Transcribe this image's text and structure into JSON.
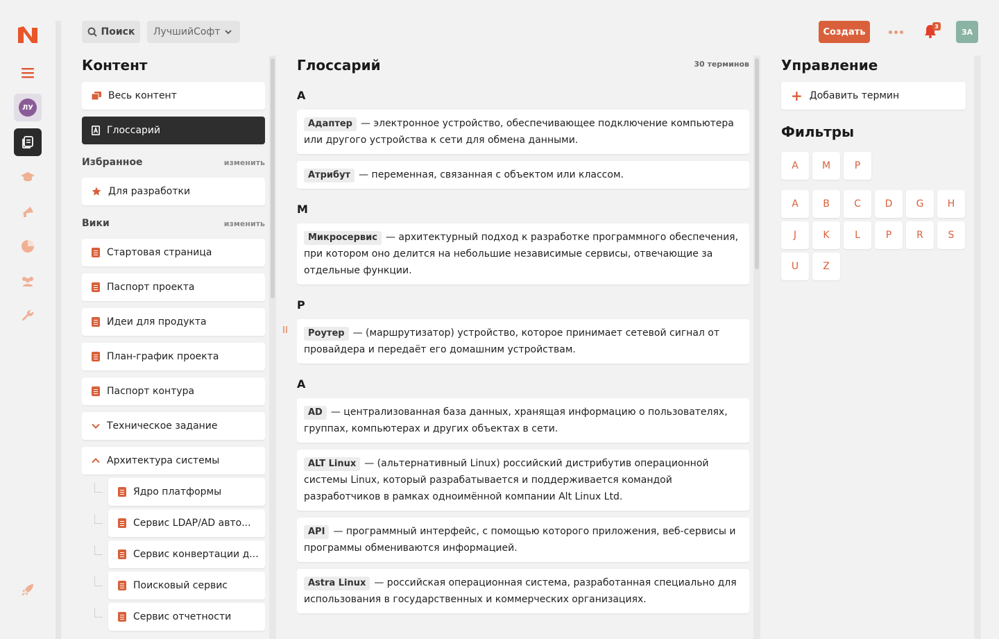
{
  "topbar": {
    "search_label": "Поиск",
    "org_name": "ЛучшийСофт",
    "create_label": "Создать",
    "notifications_count": "3",
    "user_initials": "ЗА"
  },
  "rail": {
    "space_initials": "ЛУ"
  },
  "content_panel": {
    "title": "Контент",
    "all_content": "Весь контент",
    "glossary": "Глоссарий",
    "favorites_title": "Избранное",
    "favorites_edit": "изменить",
    "favorites": [
      "Для разработки"
    ],
    "wiki_title": "Вики",
    "wiki_edit": "изменить",
    "wiki_items": [
      "Стартовая страница",
      "Паспорт проекта",
      "Идеи для продукта",
      "План-график проекта",
      "Паспорт контура"
    ],
    "tech_spec": "Техническое задание",
    "arch": "Архитектура системы",
    "arch_children": [
      "Ядро платформы",
      "Сервис LDAP/AD авто...",
      "Сервис конвертации д...",
      "Поисковый сервис",
      "Сервис отчетности"
    ]
  },
  "glossary": {
    "title": "Глоссарий",
    "count": "30 терминов",
    "groups": [
      {
        "letter": "А",
        "terms": [
          {
            "term": "Адаптер",
            "def": "— электронное устройство, обеспечивающее подключение компьютера или другого устройства к сети для обмена данными."
          },
          {
            "term": "Атрибут",
            "def": "— переменная, связанная с объектом или классом."
          }
        ]
      },
      {
        "letter": "М",
        "terms": [
          {
            "term": "Микросервис",
            "def": "— архитектурный подход к разработке программного обеспечения, при котором оно делится на небольшие независимые сервисы, отвечающие за отдельные функции."
          }
        ]
      },
      {
        "letter": "Р",
        "terms": [
          {
            "term": "Роутер",
            "def": "— (маршрутизатор) устройство, которое принимает сетевой сигнал от провайдера и передаёт его домашним устройствам."
          }
        ]
      },
      {
        "letter": "A",
        "terms": [
          {
            "term": "AD",
            "def": "— централизованная база данных, хранящая информацию о пользователях, группах, компьютерах и других объектах в сети."
          },
          {
            "term": "ALT Linux",
            "def": "— (альтернативный Linux) российский дистрибутив операционной системы Linux, который разрабатывается и поддерживается командой разработчиков в рамках одноимённой компании Alt Linux Ltd."
          },
          {
            "term": "API",
            "def": "— программный интерфейс, с помощью которого приложения, веб-сервисы и программы обмениваются информацией."
          },
          {
            "term": "Astra Linux",
            "def": "— российская операционная система, разработанная специально для использования в государственных и коммерческих организациях."
          }
        ]
      }
    ]
  },
  "management": {
    "title": "Управление",
    "add_term": "Добавить термин",
    "filters_title": "Фильтры",
    "cyrillic_letters": [
      "А",
      "М",
      "Р"
    ],
    "latin_letters": [
      "A",
      "B",
      "C",
      "D",
      "G",
      "H",
      "J",
      "K",
      "L",
      "P",
      "R",
      "S",
      "U",
      "Z"
    ]
  },
  "colors": {
    "accent": "#d9603a",
    "active_nav": "#2e2e2e",
    "background": "#f2f2f2"
  }
}
